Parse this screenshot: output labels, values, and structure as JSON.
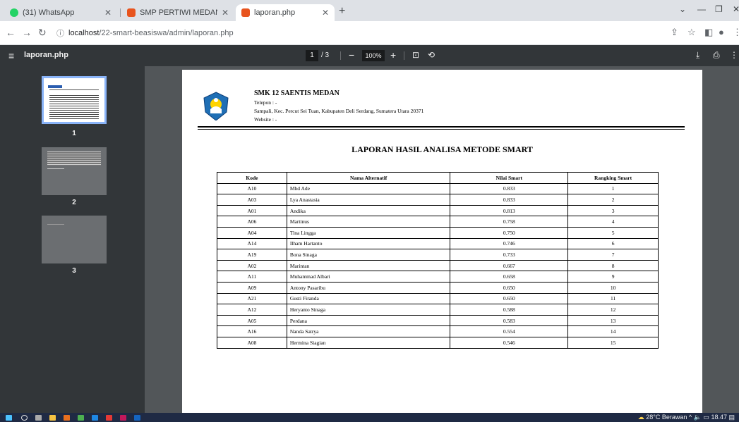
{
  "browser": {
    "tabs": [
      {
        "label": "(31) WhatsApp",
        "icon": "whatsapp-icon",
        "color": "#25d366"
      },
      {
        "label": "SMP PERTIWI MEDAN",
        "icon": "codeigniter-icon",
        "color": "#e8541e"
      },
      {
        "label": "laporan.php",
        "icon": "codeigniter-icon",
        "color": "#e8541e"
      }
    ],
    "url_host": "localhost",
    "url_path": "/22-smart-beasiswa/admin/laporan.php"
  },
  "pdf_toolbar": {
    "filename": "laporan.php",
    "current_page": "1",
    "total_pages": "/ 3",
    "zoom": "100%"
  },
  "thumbnails": [
    {
      "label": "1"
    },
    {
      "label": "2"
    },
    {
      "label": "3"
    }
  ],
  "report": {
    "school_name": "SMK 12 SAENTIS MEDAN",
    "phone": "Telepon : -",
    "address": "Sampali, Kec. Percut Sei Tuan, Kabupaten Deli Serdang, Sumatera Utara 20371",
    "website": "Website : -",
    "title": "LAPORAN HASIL ANALISA METODE SMART",
    "columns": [
      "Kode",
      "Nama Alternatif",
      "Nilai Smart",
      "Rangking Smart"
    ],
    "rows": [
      [
        "A10",
        "Mhd Ade",
        "0.833",
        "1"
      ],
      [
        "A03",
        "Lya Anastasia",
        "0.833",
        "2"
      ],
      [
        "A01",
        "Andika",
        "0.813",
        "3"
      ],
      [
        "A06",
        "Martinus",
        "0.758",
        "4"
      ],
      [
        "A04",
        "Tina Lingga",
        "0.750",
        "5"
      ],
      [
        "A14",
        "Ilham Hartanto",
        "0.746",
        "6"
      ],
      [
        "A19",
        "Bona Sinaga",
        "0.733",
        "7"
      ],
      [
        "A02",
        "Marintan",
        "0.667",
        "8"
      ],
      [
        "A11",
        "Muhammad Albari",
        "0.658",
        "9"
      ],
      [
        "A09",
        "Antony Pasaribu",
        "0.650",
        "10"
      ],
      [
        "A21",
        "Gusti Firanda",
        "0.650",
        "11"
      ],
      [
        "A12",
        "Heryanto Sinaga",
        "0.588",
        "12"
      ],
      [
        "A05",
        "Perdana",
        "0.583",
        "13"
      ],
      [
        "A16",
        "Nanda Satrya",
        "0.554",
        "14"
      ],
      [
        "A08",
        "Hermina Siagian",
        "0.546",
        "15"
      ]
    ]
  },
  "taskbar": {
    "weather": "28°C Berawan",
    "time": "18.47"
  }
}
